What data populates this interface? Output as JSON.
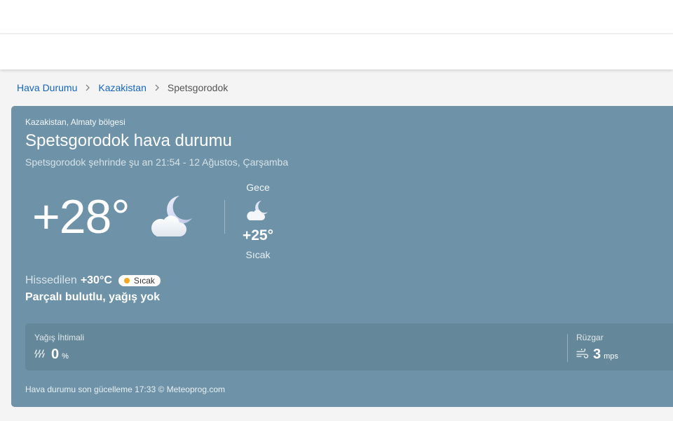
{
  "breadcrumb": {
    "items": [
      "Hava Durumu",
      "Kazakistan"
    ],
    "current": "Spetsgorodok"
  },
  "weather": {
    "region": "Kazakistan, Almaty bölgesi",
    "title": "Spetsgorodok hava durumu",
    "subtitle": "Spetsgorodok şehrinde şu an 21:54 - 12 Ağustos, Çarşamba",
    "current_temp": "+28°",
    "current_icon": "moon-cloud-icon",
    "night": {
      "label": "Gece",
      "temp": "+25°",
      "desc": "Sıcak",
      "icon": "moon-cloud-icon"
    },
    "feels_label": "Hissedilen",
    "feels_value": "+30°C",
    "badge": "Sıcak",
    "condition": "Parçalı bulutlu, yağış yok",
    "rain": {
      "label": "Yağış İhtimali",
      "value": "0",
      "unit": "%",
      "icon": "rain-icon"
    },
    "wind": {
      "label": "Rüzgar",
      "value": "3",
      "unit": "mps",
      "icon": "wind-icon"
    },
    "footer": "Hava durumu son gücelleme 17:33 © Meteoprog.com"
  },
  "colors": {
    "card_bg": "#6e93a8",
    "stats_bg": "#648799",
    "link": "#1565c0",
    "badge_dot": "#f5a623"
  }
}
